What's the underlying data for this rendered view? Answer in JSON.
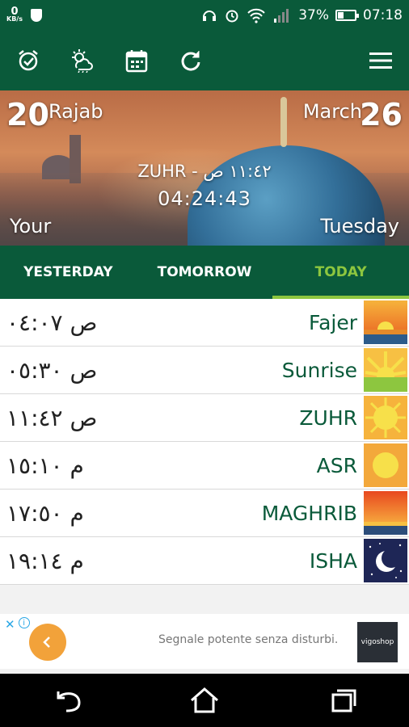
{
  "status": {
    "speed_value": "0",
    "speed_unit": "KB/s",
    "battery": "37%",
    "time": "07:18",
    "battery_level": 0.37
  },
  "toolbar": {
    "icons": [
      "alarm-icon",
      "weather-icon",
      "calendar-icon",
      "refresh-icon",
      "menu-icon"
    ]
  },
  "hero": {
    "hijri_day": "20",
    "hijri_month": "Rajab",
    "greg_month": "March",
    "greg_day": "26",
    "next_prayer": "ZUHR - ١١:٤٢ ص",
    "countdown": "04:24:43",
    "location": "Your",
    "weekday": "Tuesday"
  },
  "tabs": [
    "YESTERDAY",
    "TOMORROW",
    "TODAY"
  ],
  "prayers": [
    {
      "name": "Fajer",
      "time": "ص ٠٤:٠٧"
    },
    {
      "name": "Sunrise",
      "time": "ص ٠٥:٣٠"
    },
    {
      "name": "ZUHR",
      "time": "ص ١١:٤٢"
    },
    {
      "name": "ASR",
      "time": "م ١٥:١٠"
    },
    {
      "name": "MAGHRIB",
      "time": "م ١٧:٥٠"
    },
    {
      "name": "ISHA",
      "time": "م ١٩:١٤"
    }
  ],
  "ad": {
    "text": "Segnale potente senza disturbi.",
    "brand": "vigoshop"
  }
}
